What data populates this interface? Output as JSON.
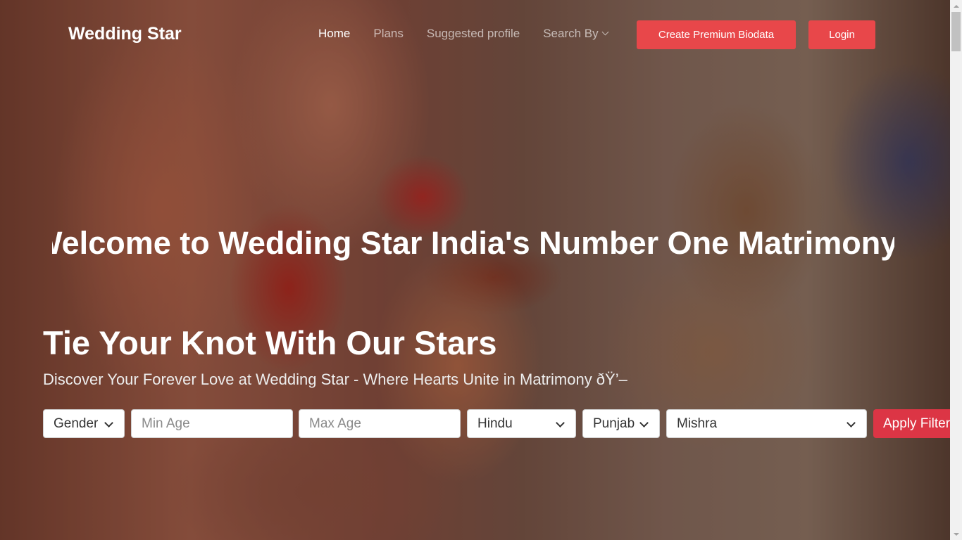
{
  "brand": {
    "name": "Wedding Star"
  },
  "nav": {
    "home": "Home",
    "plans": "Plans",
    "suggested": "Suggested profile",
    "search_by": "Search By"
  },
  "buttons": {
    "premium": "Create Premium Biodata",
    "login": "Login",
    "apply": "Apply Filters"
  },
  "hero": {
    "marquee": "Welcome to Wedding Star India's Number One Matrimony",
    "headline": "Tie Your Knot With Our Stars",
    "subline": "Discover Your Forever Love at Wedding Star - Where Hearts Unite in Matrimony ðŸ’–"
  },
  "filters": {
    "gender": "Gender",
    "min_age_placeholder": "Min Age",
    "max_age_placeholder": "Max Age",
    "religion": "Hindu",
    "state": "Punjab",
    "caste": "Mishra"
  },
  "colors": {
    "accent": "#e8474a",
    "apply": "#dc3545"
  },
  "icons": {
    "dropdown": "chevron-down-icon",
    "scroll_up": "scroll-up-arrow",
    "scroll_down": "scroll-down-arrow"
  }
}
